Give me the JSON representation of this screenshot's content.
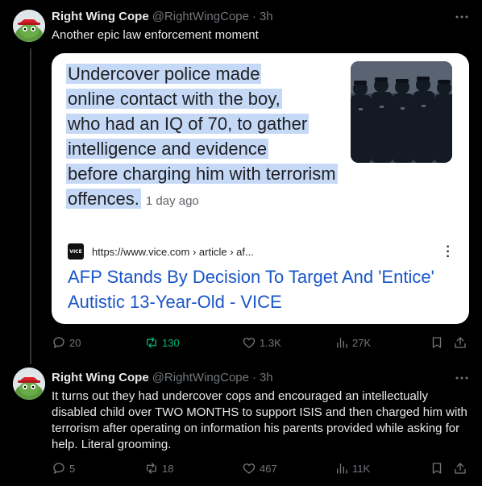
{
  "tweets": [
    {
      "author_name": "Right Wing Cope",
      "handle": "@RightWingCope",
      "time": "3h",
      "text": "Another epic law enforcement moment",
      "card": {
        "headline_lines": [
          "Undercover police made",
          "online contact with the boy,",
          "who had an IQ of 70, to gather",
          "intelligence and evidence",
          "before charging him with terrorism",
          "offences."
        ],
        "age": "1 day ago",
        "favicon_text": "VICE",
        "source_url": "https://www.vice.com › article › af...",
        "link_title": "AFP Stands By Decision To Target And 'Entice' Autistic 13-Year-Old - VICE"
      },
      "actions": {
        "replies": "20",
        "retweets": "130",
        "likes": "1.3K",
        "views": "27K"
      }
    },
    {
      "author_name": "Right Wing Cope",
      "handle": "@RightWingCope",
      "time": "3h",
      "text": "It turns out they had undercover cops and encouraged an intellectually disabled child over TWO MONTHS to support ISIS and then charged him with terrorism after operating on information his parents provided while asking for help. Literal grooming.",
      "actions": {
        "replies": "5",
        "retweets": "18",
        "likes": "467",
        "views": "11K"
      }
    }
  ],
  "colors": {
    "background": "#000000",
    "muted": "#71767b",
    "retweet_active": "#00ba7c",
    "highlight": "#c5d9f7",
    "link": "#1a56c7"
  },
  "icons": [
    "reply-icon",
    "retweet-icon",
    "like-icon",
    "views-icon",
    "bookmark-icon",
    "share-icon",
    "more-icon"
  ]
}
